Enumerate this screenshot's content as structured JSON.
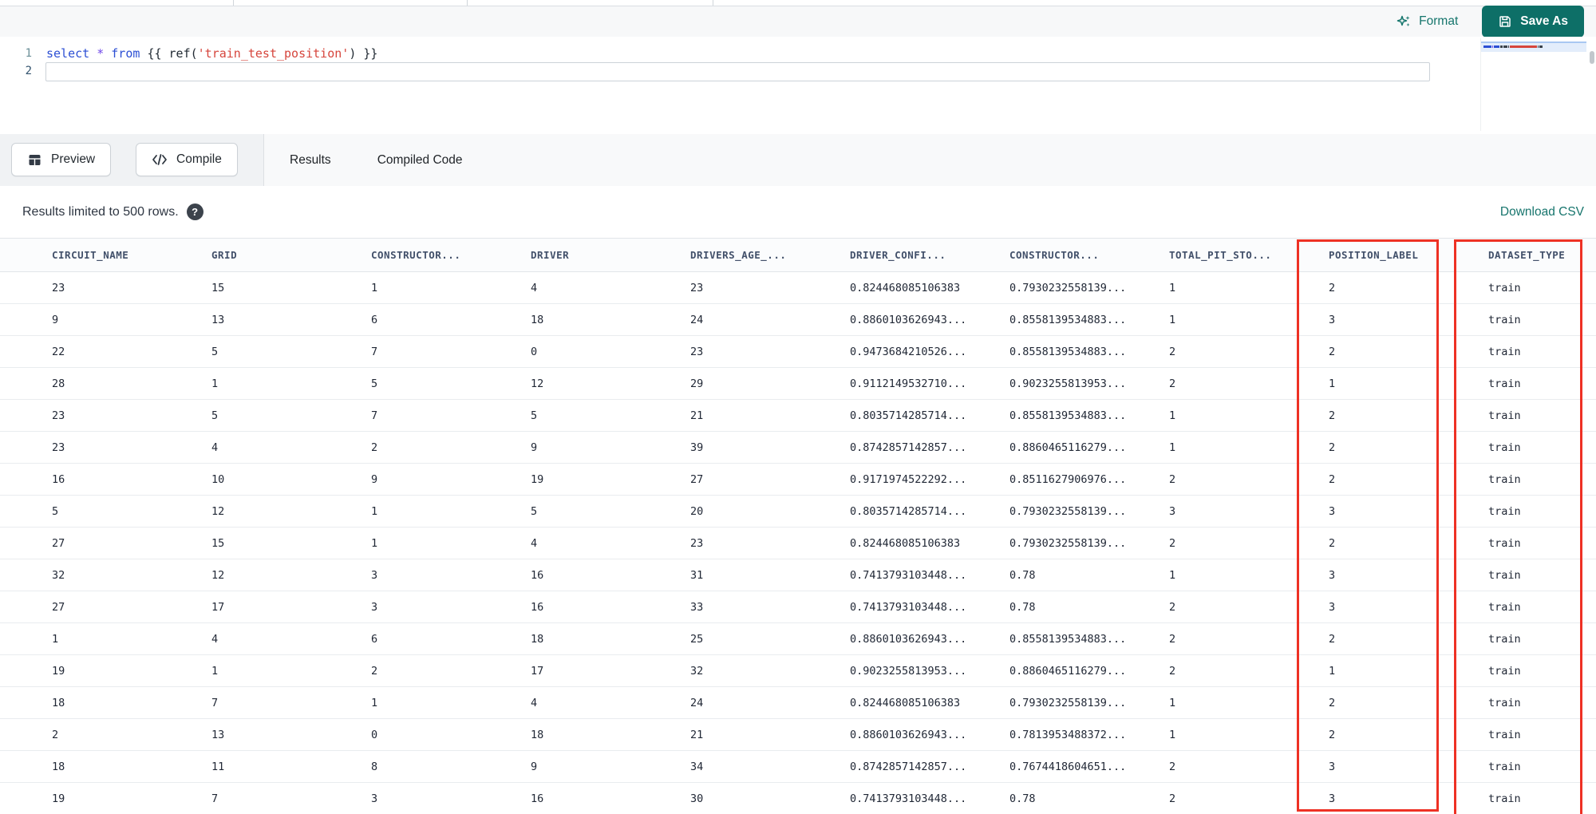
{
  "colors": {
    "accent_teal": "#0d6f67",
    "teal_text": "#15756c",
    "annotation_red": "#ee3124"
  },
  "toolbar": {
    "format_label": "Format",
    "save_as_label": "Save As"
  },
  "editor": {
    "lines": [
      {
        "number": "1",
        "tokens": [
          {
            "text": "select",
            "type": "keyword"
          },
          {
            "text": " ",
            "type": "plain"
          },
          {
            "text": "*",
            "type": "star"
          },
          {
            "text": " ",
            "type": "plain"
          },
          {
            "text": "from",
            "type": "keyword"
          },
          {
            "text": " ",
            "type": "plain"
          },
          {
            "text": "{{ ",
            "type": "plain"
          },
          {
            "text": "ref",
            "type": "plain"
          },
          {
            "text": "(",
            "type": "plain"
          },
          {
            "text": "'train_test_position'",
            "type": "string"
          },
          {
            "text": ")",
            "type": "plain"
          },
          {
            "text": " }}",
            "type": "plain"
          }
        ]
      },
      {
        "number": "2",
        "tokens": []
      }
    ]
  },
  "actions": {
    "preview_label": "Preview",
    "compile_label": "Compile"
  },
  "tabs": [
    {
      "label": "Results",
      "active": true
    },
    {
      "label": "Compiled Code",
      "active": false
    }
  ],
  "results_bar": {
    "note": "Results limited to 500 rows.",
    "help_icon": "question-mark-icon",
    "download_label": "Download CSV"
  },
  "table": {
    "columns": [
      "CIRCUIT_NAME",
      "GRID",
      "CONSTRUCTOR...",
      "DRIVER",
      "DRIVERS_AGE_...",
      "DRIVER_CONFI...",
      "CONSTRUCTOR...",
      "TOTAL_PIT_STO...",
      "POSITION_LABEL",
      "DATASET_TYPE"
    ],
    "rows": [
      [
        "23",
        "15",
        "1",
        "4",
        "23",
        "0.824468085106383",
        "0.7930232558139...",
        "1",
        "2",
        "train"
      ],
      [
        "9",
        "13",
        "6",
        "18",
        "24",
        "0.8860103626943...",
        "0.8558139534883...",
        "1",
        "3",
        "train"
      ],
      [
        "22",
        "5",
        "7",
        "0",
        "23",
        "0.9473684210526...",
        "0.8558139534883...",
        "2",
        "2",
        "train"
      ],
      [
        "28",
        "1",
        "5",
        "12",
        "29",
        "0.9112149532710...",
        "0.9023255813953...",
        "2",
        "1",
        "train"
      ],
      [
        "23",
        "5",
        "7",
        "5",
        "21",
        "0.8035714285714...",
        "0.8558139534883...",
        "1",
        "2",
        "train"
      ],
      [
        "23",
        "4",
        "2",
        "9",
        "39",
        "0.8742857142857...",
        "0.8860465116279...",
        "1",
        "2",
        "train"
      ],
      [
        "16",
        "10",
        "9",
        "19",
        "27",
        "0.9171974522292...",
        "0.8511627906976...",
        "2",
        "2",
        "train"
      ],
      [
        "5",
        "12",
        "1",
        "5",
        "20",
        "0.8035714285714...",
        "0.7930232558139...",
        "3",
        "3",
        "train"
      ],
      [
        "27",
        "15",
        "1",
        "4",
        "23",
        "0.824468085106383",
        "0.7930232558139...",
        "2",
        "2",
        "train"
      ],
      [
        "32",
        "12",
        "3",
        "16",
        "31",
        "0.7413793103448...",
        "0.78",
        "1",
        "3",
        "train"
      ],
      [
        "27",
        "17",
        "3",
        "16",
        "33",
        "0.7413793103448...",
        "0.78",
        "2",
        "3",
        "train"
      ],
      [
        "1",
        "4",
        "6",
        "18",
        "25",
        "0.8860103626943...",
        "0.8558139534883...",
        "2",
        "2",
        "train"
      ],
      [
        "19",
        "1",
        "2",
        "17",
        "32",
        "0.9023255813953...",
        "0.8860465116279...",
        "2",
        "1",
        "train"
      ],
      [
        "18",
        "7",
        "1",
        "4",
        "24",
        "0.824468085106383",
        "0.7930232558139...",
        "1",
        "2",
        "train"
      ],
      [
        "2",
        "13",
        "0",
        "18",
        "21",
        "0.8860103626943...",
        "0.7813953488372...",
        "1",
        "2",
        "train"
      ],
      [
        "18",
        "11",
        "8",
        "9",
        "34",
        "0.8742857142857...",
        "0.7674418604651...",
        "2",
        "3",
        "train"
      ],
      [
        "19",
        "7",
        "3",
        "16",
        "30",
        "0.7413793103448...",
        "0.78",
        "2",
        "3",
        "train"
      ]
    ]
  },
  "annotations": {
    "highlighted_columns": [
      "POSITION_LABEL",
      "DATASET_TYPE"
    ],
    "box_color": "#ee3124"
  }
}
